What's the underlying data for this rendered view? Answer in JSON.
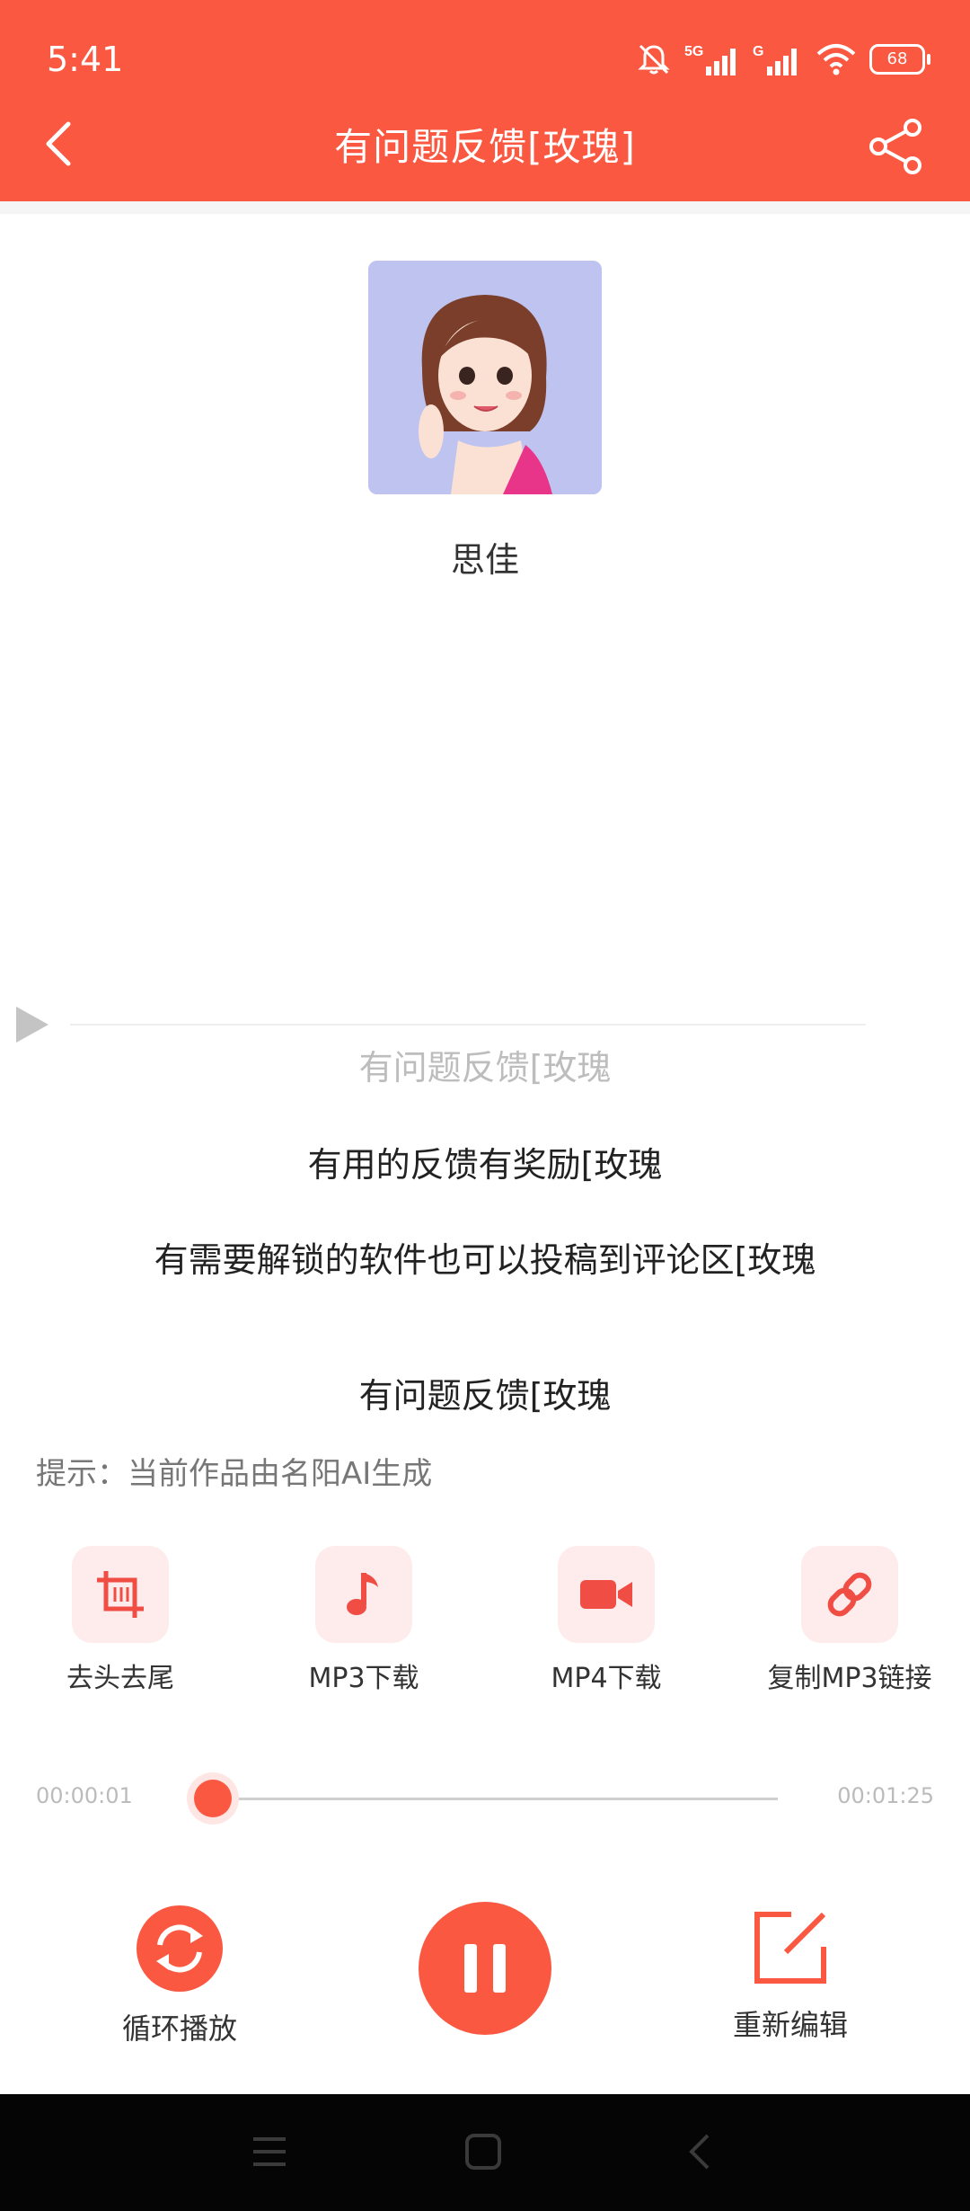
{
  "status_bar": {
    "time": "5:41",
    "battery": "68",
    "network_1": "5G",
    "network_2": "G"
  },
  "header": {
    "title": "有问题反馈[玫瑰]",
    "bg_color": "#fb5842"
  },
  "author": {
    "name": "思佳"
  },
  "lyrics": [
    {
      "text": "有问题反馈[玫瑰",
      "state": "dim"
    },
    {
      "text": "有用的反馈有奖励[玫瑰",
      "state": "normal"
    },
    {
      "text": "有需要解锁的软件也可以投稿到评论区[玫瑰",
      "state": "normal"
    },
    {
      "text": "有问题反馈[玫瑰",
      "state": "normal"
    }
  ],
  "hint": "提示：当前作品由名阳AI生成",
  "tools": [
    {
      "label": "去头去尾",
      "icon": "crop-icon"
    },
    {
      "label": "MP3下载",
      "icon": "music-note-icon"
    },
    {
      "label": "MP4下载",
      "icon": "video-camera-icon"
    },
    {
      "label": "复制MP3链接",
      "icon": "link-icon"
    }
  ],
  "player": {
    "current_time": "00:00:01",
    "total_time": "00:01:25",
    "progress_fraction": 0.01
  },
  "controls": {
    "loop_label": "循环播放",
    "reedit_label": "重新编辑"
  },
  "colors": {
    "accent": "#fb5842",
    "tool_bg": "#fdeceb"
  }
}
